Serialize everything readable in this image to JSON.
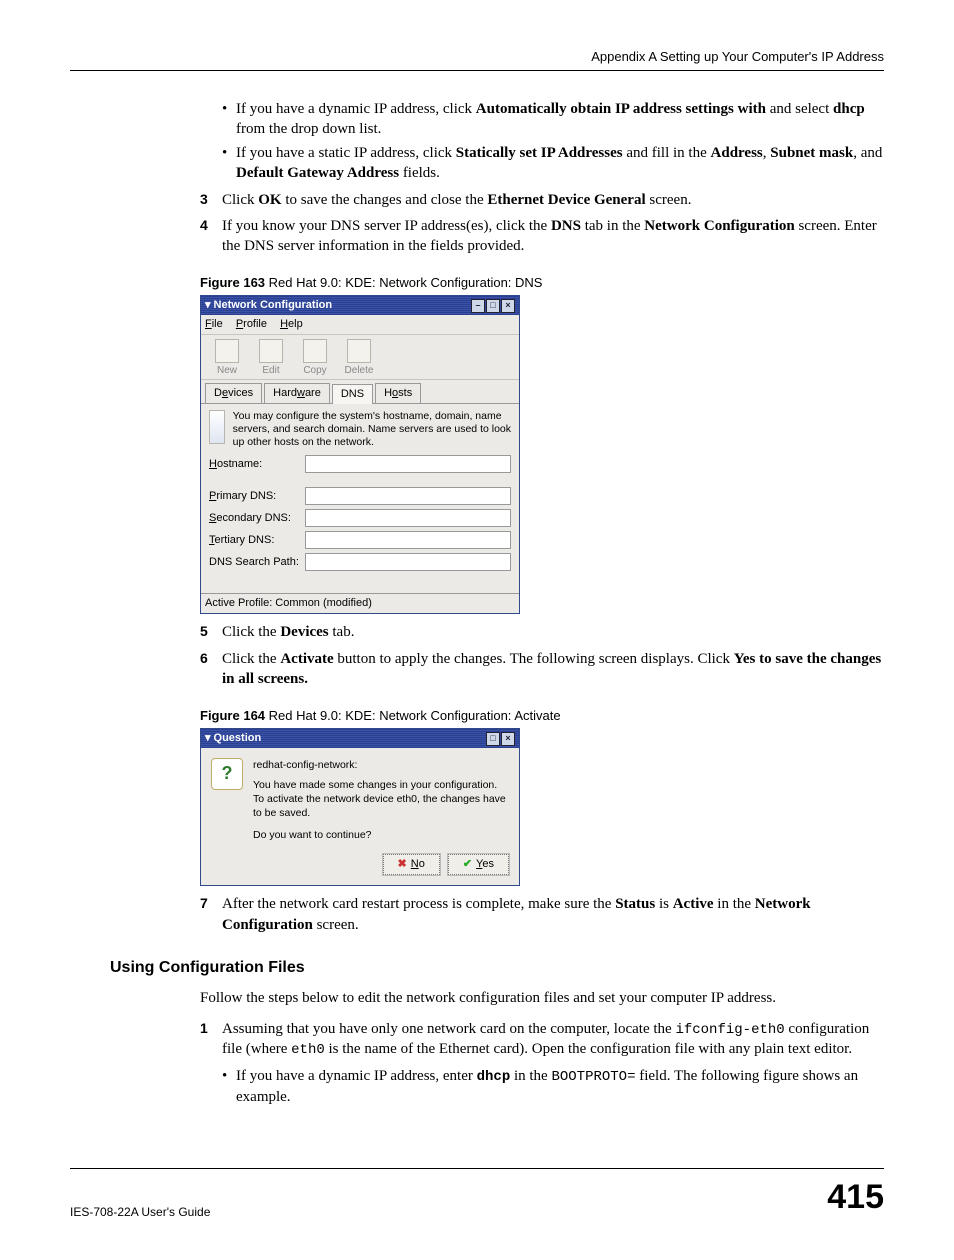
{
  "header": {
    "breadcrumb": "Appendix A Setting up Your Computer's IP Address"
  },
  "bullets1": {
    "b1_pre": "If you have a dynamic IP address, click ",
    "b1_bold1": "Automatically obtain IP address settings with",
    "b1_mid": " and select ",
    "b1_bold2": "dhcp",
    "b1_post": " from the drop down list.",
    "b2_pre": "If you have a static IP address, click ",
    "b2_bold1": "Statically set IP Addresses",
    "b2_mid": " and fill in the ",
    "b2_bold2": "Address",
    "b2_sep1": ", ",
    "b2_bold3": "Subnet mask",
    "b2_sep2": ", and ",
    "b2_bold4": "Default Gateway Address",
    "b2_post": " fields."
  },
  "step3": {
    "num": "3",
    "pre": "Click ",
    "bold1": "OK",
    "mid": " to save the changes and close the ",
    "bold2": "Ethernet Device General",
    "post": " screen."
  },
  "step4": {
    "num": "4",
    "pre": "If you know your DNS server IP address(es), click the ",
    "bold1": "DNS",
    "mid": " tab in the ",
    "bold2": "Network Configuration",
    "post": " screen. Enter the DNS server information in the fields provided."
  },
  "fig163": {
    "label": "Figure 163",
    "caption": "   Red Hat 9.0: KDE: Network Configuration: DNS"
  },
  "win1": {
    "title": "Network Configuration",
    "menu": {
      "file": "File",
      "profile": "Profile",
      "help": "Help"
    },
    "toolbar": {
      "new": "New",
      "edit": "Edit",
      "copy": "Copy",
      "delete": "Delete"
    },
    "tabs": {
      "devices": "Devices",
      "hardware": "Hardware",
      "dns": "DNS",
      "hosts": "Hosts"
    },
    "desc": "You may configure the system's hostname, domain, name servers, and search domain. Name servers are used to look up other hosts on the network.",
    "labels": {
      "hostname": "Hostname:",
      "pdns": "Primary DNS:",
      "sdns": "Secondary DNS:",
      "tdns": "Tertiary DNS:",
      "search": "DNS Search Path:"
    },
    "status": "Active Profile: Common (modified)"
  },
  "step5": {
    "num": "5",
    "pre": "Click the ",
    "bold1": "Devices",
    "post": " tab."
  },
  "step6": {
    "num": "6",
    "pre": "Click the ",
    "bold1": "Activate",
    "mid": " button to apply the changes. The following screen displays. Click ",
    "bold2": "Yes to save the changes in all screens."
  },
  "fig164": {
    "label": "Figure 164",
    "caption": "   Red Hat 9.0: KDE: Network Configuration: Activate"
  },
  "win2": {
    "title": "Question",
    "heading": "redhat-config-network:",
    "body1": "You have made some changes in your configuration.",
    "body2": "To activate the network device eth0, the changes have to be saved.",
    "body3": "Do you want to continue?",
    "no": "No",
    "yes": "Yes"
  },
  "step7": {
    "num": "7",
    "pre": "After the network card restart process is complete, make sure the ",
    "bold1": "Status",
    "mid": " is ",
    "bold2": "Active",
    "mid2": " in the ",
    "bold3": "Network Configuration",
    "post": " screen."
  },
  "section": {
    "heading": "Using Configuration Files",
    "intro": "Follow the steps below to edit the network configuration files and set your computer IP address."
  },
  "cstep1": {
    "num": "1",
    "pre": "Assuming that you have only one network card on the computer, locate the ",
    "code1": "ifconfig-eth0",
    "mid": " configuration file (where ",
    "code2": "eth0",
    "post": " is the name of the Ethernet card). Open the configuration file with any plain text editor.",
    "sub_pre": "If you have a dynamic IP address, enter ",
    "sub_bold": "dhcp",
    "sub_mid": " in the ",
    "sub_code": "BOOTPROTO=",
    "sub_post": " field.  The following figure shows an example."
  },
  "footer": {
    "guide": "IES-708-22A User's Guide",
    "page": "415"
  }
}
